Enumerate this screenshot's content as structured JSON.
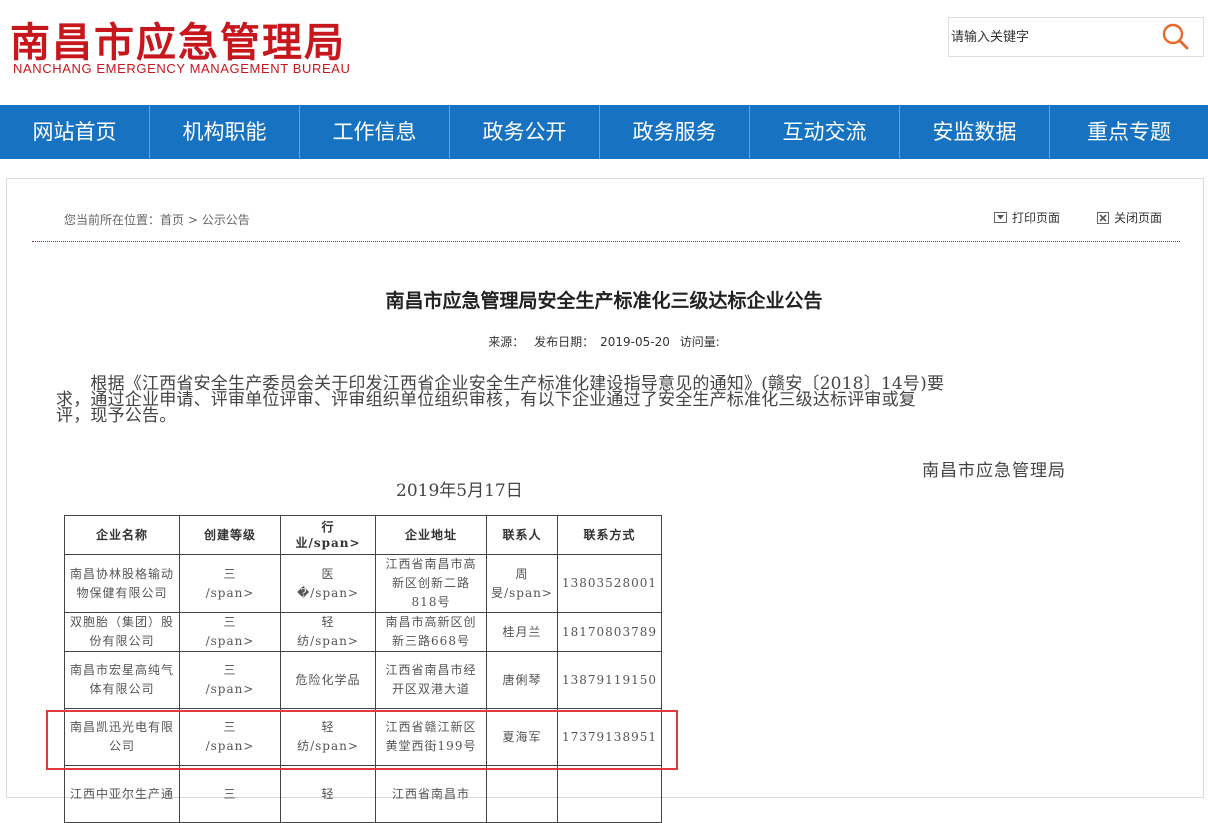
{
  "header": {
    "logo_cn": "南昌市应急管理局",
    "logo_en": "NANCHANG EMERGENCY MANAGEMENT BUREAU",
    "search_placeholder": "请输入关键字",
    "brand_color": "#c8161d"
  },
  "nav": {
    "items": [
      "网站首页",
      "机构职能",
      "工作信息",
      "政务公开",
      "政务服务",
      "互动交流",
      "安监数据",
      "重点专题"
    ],
    "bg_color": "#1773c1"
  },
  "breadcrumb": {
    "prefix": "您当前所在位置：",
    "home": "首页",
    "sep": " > ",
    "current": "公示公告"
  },
  "tools": {
    "print": "打印页面",
    "close": "关闭页面"
  },
  "article": {
    "title": "南昌市应急管理局安全生产标准化三级达标企业公告",
    "source_label": "来源：",
    "date_label": "发布日期：",
    "date": "2019-05-20",
    "visits_label": "访问量:",
    "para_line1": "　　根据《江西省安全生产委员会关于印发江西省企业安全生产标准化建设指导意见的通知》(赣安〔2018〕14号)要",
    "para_line2": "求，通过企业申请、评审单位评审、评审组织单位组织审核，有以下企业通过了安全生产标准化三级达标评审或复",
    "para_line3": "评，现予公告。",
    "sign_org": "南昌市应急管理局",
    "sign_date": "2019年5月17日"
  },
  "table": {
    "headers": [
      "企业名称",
      "创建等级",
      "行\n业/span>",
      "企业地址",
      "联系人",
      "联系方式"
    ],
    "rows": [
      [
        "南昌协林股格输动物保健有限公司",
        "三\n/span>",
        "医\n�/span>",
        "江西省南昌市高新区创新二路818号",
        "周\n旻/span>",
        "13803528001"
      ],
      [
        "双胞胎（集团）股份有限公司",
        "三\n/span>",
        "轻\n纺/span>",
        "南昌市高新区创新三路668号",
        "桂月兰",
        "18170803789"
      ],
      [
        "南昌市宏星高纯气体有限公司",
        "三\n/span>",
        "危险化学品",
        "江西省南昌市经开区双港大道",
        "唐俐琴",
        "13879119150"
      ],
      [
        "南昌凯迅光电有限公司",
        "三\n/span>",
        "轻\n纺/span>",
        "江西省赣江新区黄堂西街199号",
        "夏海军",
        "17379138951"
      ],
      [
        "江西中亚尔生产通",
        "三",
        "轻",
        "江西省南昌市",
        "",
        ""
      ]
    ],
    "highlight_color": "#e0393e"
  }
}
